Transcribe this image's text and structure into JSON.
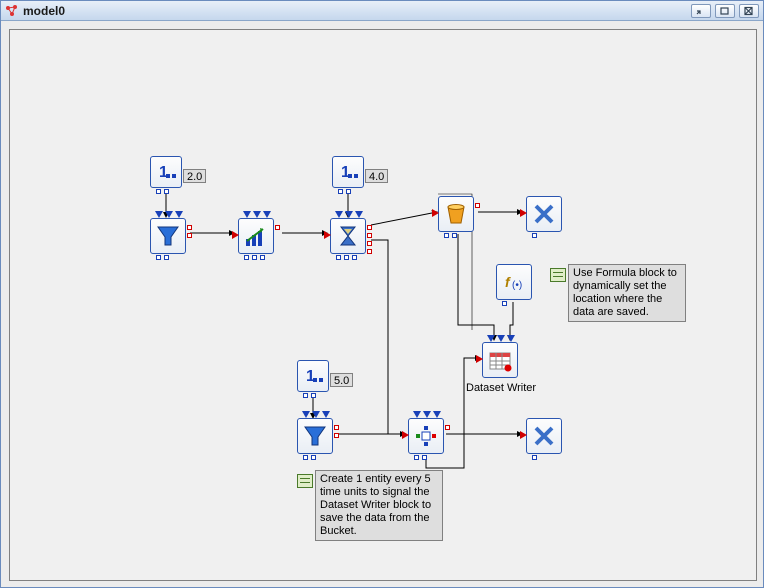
{
  "window": {
    "title": "model0"
  },
  "constants": {
    "c1": "2.0",
    "c2": "4.0",
    "c3": "5.0"
  },
  "blocks": {
    "dataset_writer_label": "Dataset Writer"
  },
  "notes": {
    "formula": "Use Formula block to dynamically set the location where the data are saved.",
    "generator": "Create 1 entity every 5 time units to signal the Dataset Writer block to save the data from the Bucket."
  }
}
